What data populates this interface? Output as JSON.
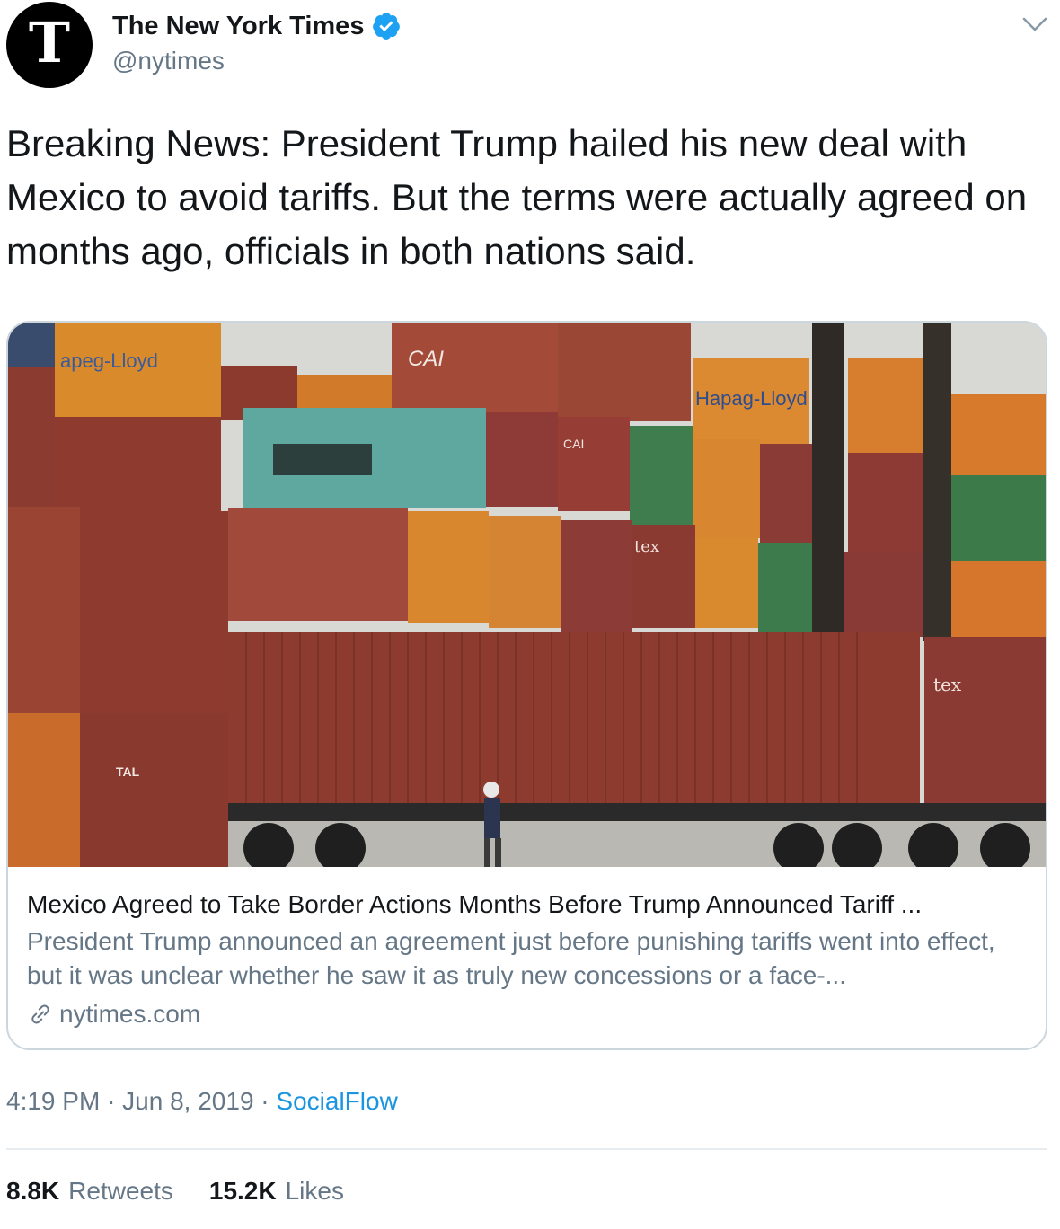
{
  "author": {
    "display_name": "The New York Times",
    "handle": "@nytimes",
    "avatar_letter": "T",
    "verified": true,
    "verified_icon": "verified-badge-icon",
    "verified_color": "#1da1f2"
  },
  "menu": {
    "icon": "chevron-down-icon"
  },
  "tweet": {
    "text": "Breaking News: President Trump hailed his new deal with Mexico to avoid tariffs. But the terms were actually agreed on months ago, officials in both nations said."
  },
  "card": {
    "image_description": "Stacked shipping containers at a port",
    "container_markings": {
      "left_brand": "apeg-Lloyd",
      "right_brand": "Hapag-Lloyd",
      "cai_1": "CAI",
      "cai_2": "CAI",
      "tex_1": "tex",
      "tex_2": "tex",
      "tal": "TAL"
    },
    "title": "Mexico Agreed to Take Border Actions Months Before Trump Announced Tariff ...",
    "description": "President Trump announced an agreement just before punishing tariffs went into effect, but it was unclear whether he saw it as truly new concessions or a face-...",
    "domain": "nytimes.com",
    "domain_icon": "link-icon"
  },
  "meta": {
    "time": "4:19 PM",
    "separator": "·",
    "date": "Jun 8, 2019",
    "source": "SocialFlow"
  },
  "stats": {
    "retweets_count": "8.8K",
    "retweets_label": "Retweets",
    "likes_count": "15.2K",
    "likes_label": "Likes"
  },
  "colors": {
    "text_primary": "#14171a",
    "text_secondary": "#657786",
    "link": "#1b95e0",
    "border": "#ccd6dd"
  }
}
